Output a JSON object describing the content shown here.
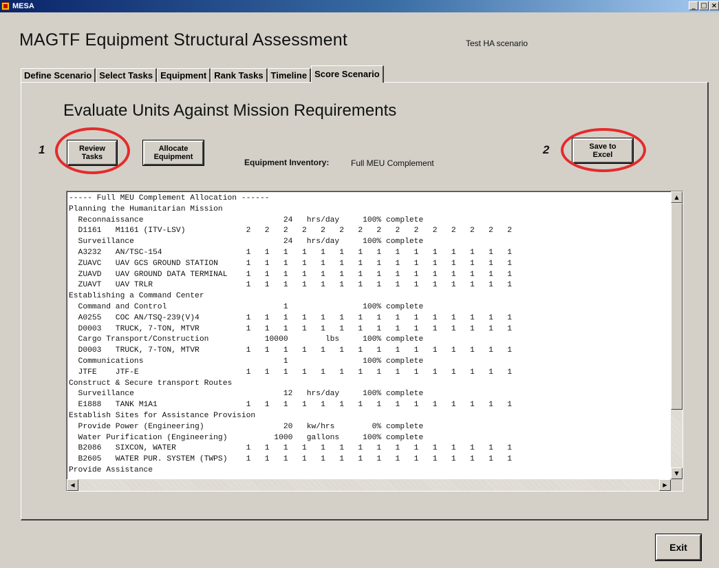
{
  "window": {
    "title": "MESA",
    "controls": [
      "_",
      "□",
      "×"
    ]
  },
  "header": {
    "title": "MAGTF Equipment Structural Assessment",
    "scenario": "Test HA scenario"
  },
  "tabs": [
    {
      "label": "Define Scenario",
      "active": false
    },
    {
      "label": "Select Tasks",
      "active": false
    },
    {
      "label": "Equipment",
      "active": false
    },
    {
      "label": "Rank Tasks",
      "active": false
    },
    {
      "label": "Timeline",
      "active": false
    },
    {
      "label": "Score Scenario",
      "active": true
    }
  ],
  "panel": {
    "heading": "Evaluate Units Against Mission Requirements",
    "review_button": [
      "Review",
      "Tasks"
    ],
    "allocate_button": [
      "Allocate",
      "Equipment"
    ],
    "save_button": [
      "Save to",
      "Excel"
    ],
    "inventory_label": "Equipment Inventory:",
    "inventory_value": "Full MEU Complement",
    "callouts": [
      "1",
      "2"
    ]
  },
  "report_lines": [
    "----- Full MEU Complement Allocation ------",
    "Planning the Humanitarian Mission",
    "  Reconnaissance                              24   hrs/day     100% complete",
    "  D1161   M1161 (ITV-LSV)             2   2   2   2   2   2   2   2   2   2   2   2   2   2   2",
    "  Surveillance                                24   hrs/day     100% complete",
    "  A3232   AN/TSC-154                  1   1   1   1   1   1   1   1   1   1   1   1   1   1   1",
    "  ZUAVC   UAV GCS GROUND STATION      1   1   1   1   1   1   1   1   1   1   1   1   1   1   1",
    "  ZUAVD   UAV GROUND DATA TERMINAL    1   1   1   1   1   1   1   1   1   1   1   1   1   1   1",
    "  ZUAVT   UAV TRLR                    1   1   1   1   1   1   1   1   1   1   1   1   1   1   1",
    "Establishing a Command Center",
    "  Command and Control                         1                100% complete",
    "  A0255   COC AN/TSQ-239(V)4          1   1   1   1   1   1   1   1   1   1   1   1   1   1   1",
    "  D0003   TRUCK, 7-TON, MTVR          1   1   1   1   1   1   1   1   1   1   1   1   1   1   1",
    "  Cargo Transport/Construction            10000        lbs     100% complete",
    "  D0003   TRUCK, 7-TON, MTVR          1   1   1   1   1   1   1   1   1   1   1   1   1   1   1",
    "  Communications                              1                100% complete",
    "  JTFE    JTF-E                       1   1   1   1   1   1   1   1   1   1   1   1   1   1   1",
    "Construct & Secure transport Routes",
    "  Surveillance                                12   hrs/day     100% complete",
    "  E1888   TANK M1A1                   1   1   1   1   1   1   1   1   1   1   1   1   1   1   1",
    "Establish Sites for Assistance Provision",
    "  Provide Power (Engineering)                 20   kw/hrs        0% complete",
    "  Water Purification (Engineering)          1000   gallons     100% complete",
    "  B2086   SIXCON, WATER               1   1   1   1   1   1   1   1   1   1   1   1   1   1   1",
    "  B2605   WATER PUR. SYSTEM (TWPS)    1   1   1   1   1   1   1   1   1   1   1   1   1   1   1",
    "Provide Assistance"
  ],
  "footer": {
    "exit_label": "Exit"
  },
  "colors": {
    "accent_oval": "#e52b2b",
    "window_bg": "#d4d0c8"
  }
}
